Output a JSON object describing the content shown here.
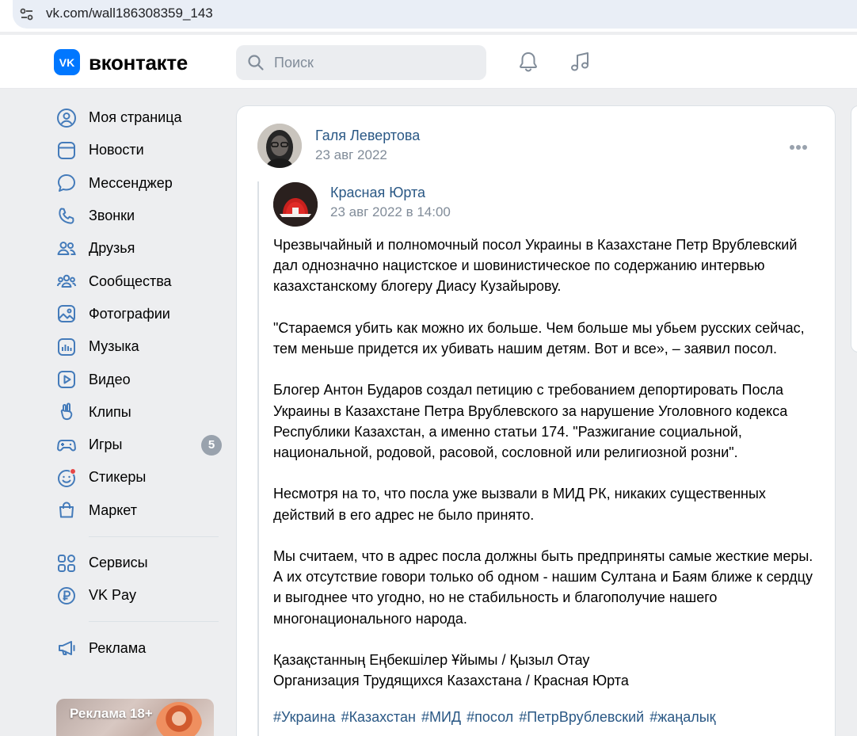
{
  "browser": {
    "url": "vk.com/wall186308359_143",
    "site_info_icon": "tune-icon"
  },
  "header": {
    "logo_text": "вконтакте",
    "search_placeholder": "Поиск",
    "icons": [
      "bell-icon",
      "music-icon"
    ],
    "brand_color": "#0077ff"
  },
  "sidebar": {
    "items": [
      {
        "label": "Моя страница",
        "icon": "profile-icon"
      },
      {
        "label": "Новости",
        "icon": "news-icon"
      },
      {
        "label": "Мессенджер",
        "icon": "messenger-icon"
      },
      {
        "label": "Звонки",
        "icon": "phone-icon"
      },
      {
        "label": "Друзья",
        "icon": "friends-icon"
      },
      {
        "label": "Сообщества",
        "icon": "communities-icon"
      },
      {
        "label": "Фотографии",
        "icon": "photos-icon"
      },
      {
        "label": "Музыка",
        "icon": "music-icon"
      },
      {
        "label": "Видео",
        "icon": "video-icon"
      },
      {
        "label": "Клипы",
        "icon": "clips-icon"
      },
      {
        "label": "Игры",
        "icon": "games-icon",
        "badge": "5"
      },
      {
        "label": "Стикеры",
        "icon": "stickers-icon"
      },
      {
        "label": "Маркет",
        "icon": "market-icon"
      }
    ],
    "secondary": [
      {
        "label": "Сервисы",
        "icon": "services-icon"
      },
      {
        "label": "VK Pay",
        "icon": "vkpay-icon"
      }
    ],
    "tertiary": [
      {
        "label": "Реклама",
        "icon": "megaphone-icon"
      }
    ],
    "ad_label": "Реклама 18+"
  },
  "post": {
    "author": "Галя Левертова",
    "date": "23 авг 2022",
    "repost": {
      "author": "Красная Юрта",
      "date": "23 авг 2022 в 14:00"
    },
    "paragraphs": [
      "Чрезвычайный и полномочный посол Украины в Казахстане Петр Врублевский дал однозначно нацистское и шовинистическое по содержанию интервью казахстанскому блогеру Диасу Кузайырову.",
      "\"Стараемся убить как можно их больше. Чем больше мы убьем русских сейчас, тем меньше придется их убивать нашим детям. Вот и все», – заявил посол.",
      "Блогер Антон Бударов создал петицию с требованием депортировать Посла Украины в Казахстане Петра Врублевского за нарушение Уголовного кодекса Республики Казахстан, а именно статьи 174. \"Разжигание социальной, национальной, родовой, расовой, сословной или религиозной розни\".",
      "Несмотря на то, что посла уже вызвали в МИД РК, никаких существенных действий в его адрес не было принято.",
      "Мы считаем, что в адрес посла должны быть предприняты самые жесткие меры. А их отсутствие говори только об одном - нашим Султана и Баям ближе к сердцу и выгоднее что угодно, но не стабильность и благополучие нашего многонационального народа."
    ],
    "signature_line_1": "Қазақстанның Еңбекшілер Ұйымы / Қызыл Отау",
    "signature_line_2": "Организация Трудящихся Казахстана / Красная Юрта",
    "hashtags": [
      "#Украина",
      "#Казахстан",
      "#МИД",
      "#посол",
      "#ПетрВрублевский",
      "#жаңалық"
    ]
  }
}
